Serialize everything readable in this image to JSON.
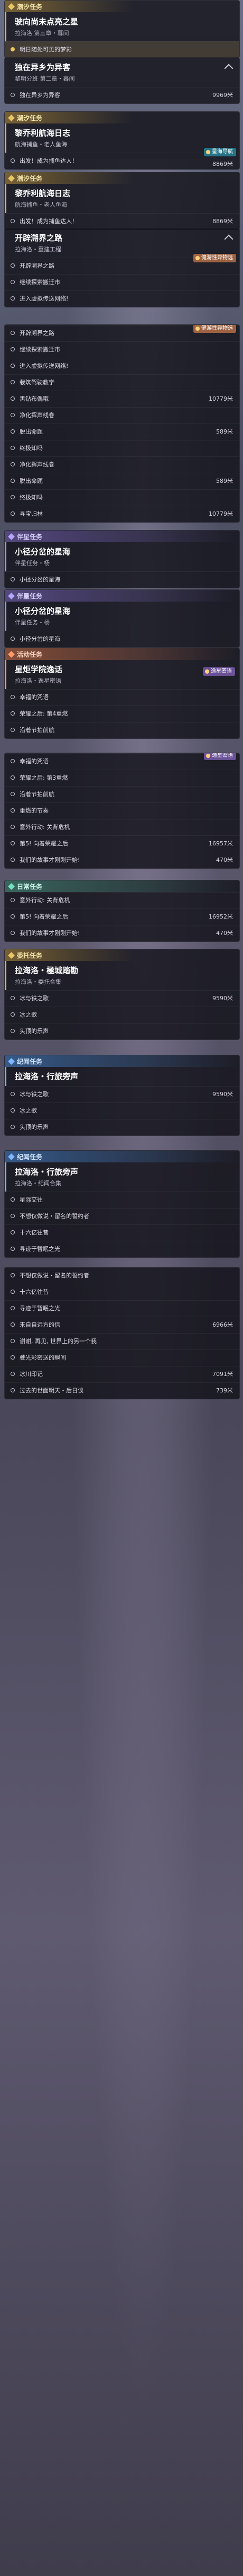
{
  "s1": {
    "category": "潮汐任务",
    "title": "驶向尚未点亮之星",
    "subtitle": "拉海洛 第三章・暮间",
    "rows": [
      {
        "text": "明日随处可见的梦影",
        "dist": ""
      }
    ]
  },
  "s2": {
    "title": "独在异乡为异客",
    "subtitle": "黎明分班 第二章・暮间",
    "rows": [
      {
        "text": "独在异乡为异客",
        "dist": "9969米"
      }
    ]
  },
  "s3": {
    "category": "潮汐任务",
    "title": "黎乔利航海日志",
    "subtitle": "航海捕鱼・老人鱼海",
    "tag": "星海导航",
    "rows": [
      {
        "text": "出发！成为捕鱼达人！",
        "dist": "8869米"
      }
    ]
  },
  "s4": {
    "category": "潮汐任务",
    "title": "黎乔利航海日志",
    "subtitle": "航海捕鱼・老人鱼海",
    "rows": [
      {
        "text": "出发！成为捕鱼达人！",
        "dist": "8869米"
      }
    ]
  },
  "s5": {
    "title": "开辟溯界之路",
    "subtitle": "拉海洛・重建工程",
    "tag": "健游性异物选",
    "rows": [
      {
        "text": "开辟溯界之路",
        "dist": ""
      },
      {
        "text": "继续探索搬迁市",
        "dist": ""
      },
      {
        "text": "进入虚拟传送网络!",
        "dist": ""
      }
    ]
  },
  "s6": {
    "tag": "健游性异物选",
    "rows": [
      {
        "text": "开辟溯界之路",
        "dist": ""
      },
      {
        "text": "继续探索搬迁市",
        "dist": ""
      },
      {
        "text": "进入虚拟传送网络!",
        "dist": ""
      },
      {
        "text": "栽筑驾驶教学",
        "dist": ""
      },
      {
        "text": "黑钻布偶哦",
        "dist": "10779米"
      },
      {
        "text": "净化挥声线卷",
        "dist": ""
      },
      {
        "text": "脱出命题",
        "dist": "589米"
      },
      {
        "text": "终极知吗",
        "dist": ""
      },
      {
        "text": "净化挥声线卷",
        "dist": ""
      },
      {
        "text": "脱出命题",
        "dist": "589米"
      },
      {
        "text": "终极知吗",
        "dist": ""
      },
      {
        "text": "寻宝归林",
        "dist": "10779米"
      }
    ]
  },
  "s7": {
    "category": "伴星任务",
    "title": "小径分岔的星海",
    "subtitle": "伴星任务・杨",
    "rows": [
      {
        "text": "小径分岔的星海",
        "dist": ""
      }
    ]
  },
  "s8": {
    "category": "伴星任务",
    "title": "小径分岔的星海",
    "subtitle": "伴星任务・杨",
    "rows": [
      {
        "text": "小径分岔的星海",
        "dist": ""
      }
    ]
  },
  "s9": {
    "category": "活动任务",
    "title": "星炬学院逸话",
    "subtitle": "拉海洛・逸星密语",
    "tag": "逸星密语",
    "rows": [
      {
        "text": "幸福的咒语",
        "dist": ""
      },
      {
        "text": "荣耀之后: 第4重燃",
        "dist": ""
      },
      {
        "text": "沿着节拍前航",
        "dist": ""
      }
    ]
  },
  "s10": {
    "tag": "逸星密语",
    "rows": [
      {
        "text": "幸福的咒语",
        "dist": ""
      },
      {
        "text": "荣耀之后: 第3重燃",
        "dist": ""
      },
      {
        "text": "沿着节拍前航",
        "dist": ""
      },
      {
        "text": "重燃的节奏",
        "dist": ""
      },
      {
        "text": "意外行动: 关背危机",
        "dist": ""
      },
      {
        "text": "第5! 向着荣耀之后",
        "dist": "16957米"
      },
      {
        "text": "我们的故事才刚刚开始!",
        "dist": "470米"
      }
    ]
  },
  "s11": {
    "category": "日常任务",
    "rows": [
      {
        "text": "意外行动: 关背危机",
        "dist": ""
      },
      {
        "text": "第5! 向着荣耀之后",
        "dist": "16952米"
      },
      {
        "text": "我们的故事才刚刚开始!",
        "dist": "470米"
      }
    ]
  },
  "s12": {
    "category": "委托任务",
    "title": "拉海洛・極城踏勘",
    "subtitle": "拉海洛・委托合集",
    "rows": [
      {
        "text": "冰与铁之歌",
        "dist": "9590米"
      },
      {
        "text": "冰之歌",
        "dist": ""
      },
      {
        "text": "头顶的乐声",
        "dist": ""
      }
    ]
  },
  "s13": {
    "category": "纪闻任务",
    "title": "拉海洛・行旅旁声",
    "subtitle": "",
    "rows": [
      {
        "text": "冰与铁之歌",
        "dist": "9590米"
      },
      {
        "text": "冰之歌",
        "dist": ""
      },
      {
        "text": "头顶的乐声",
        "dist": ""
      }
    ]
  },
  "s14": {
    "category": "纪闻任务",
    "title": "拉海洛・行旅旁声",
    "subtitle": "拉海洛・纪闻合集",
    "rows": [
      {
        "text": "星际交往",
        "dist": ""
      },
      {
        "text": "不想仅做说・留名的誓约者",
        "dist": ""
      },
      {
        "text": "十六亿往昔",
        "dist": ""
      },
      {
        "text": "寻迹于暂眠之光",
        "dist": ""
      }
    ]
  },
  "s15": {
    "rows": [
      {
        "text": "不想仅做说・留名的誓约者",
        "dist": ""
      },
      {
        "text": "十六亿往昔",
        "dist": ""
      },
      {
        "text": "寻迹于暂眠之光",
        "dist": ""
      },
      {
        "text": "来自自远方的信",
        "dist": "6966米"
      },
      {
        "text": "谢谢, 再见, 世界上的另一个我",
        "dist": ""
      },
      {
        "text": "驶光彩密送的瞬间",
        "dist": ""
      },
      {
        "text": "冰川印记",
        "dist": "7091米"
      },
      {
        "text": "过去的世面明天・后日谈",
        "dist": "739米"
      }
    ]
  }
}
